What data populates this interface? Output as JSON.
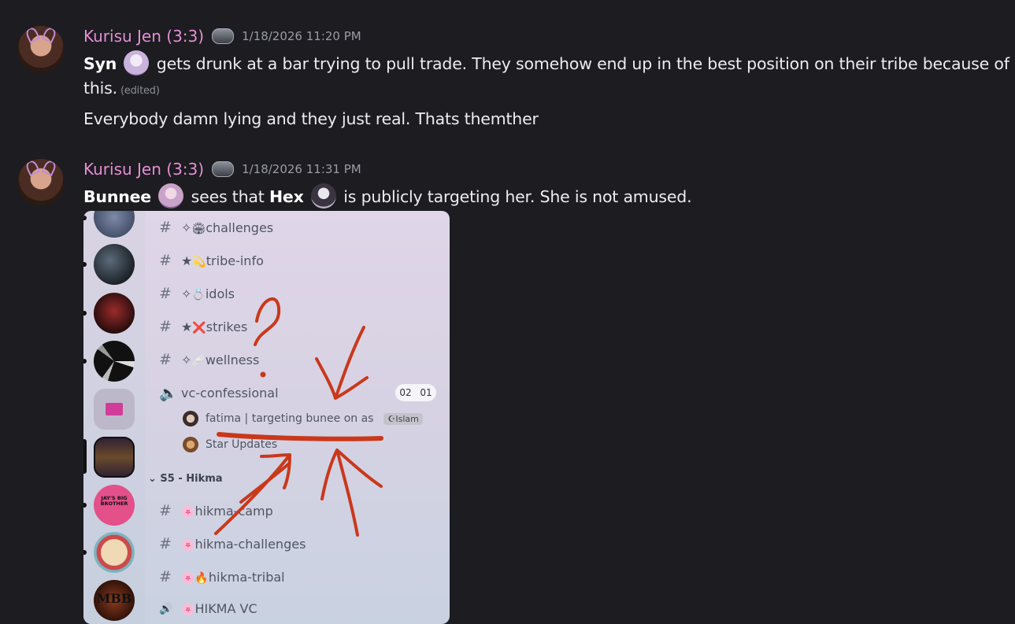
{
  "messages": [
    {
      "username": "Kurisu Jen (3:3)",
      "timestamp": "1/18/2026 11:20 PM",
      "line1_name": "Syn",
      "line1_text": "gets drunk at a bar trying to pull trade. They somehow end up in the best position on their tribe because of",
      "line2_text": "this.",
      "edited_label": "(edited)",
      "line3_text": "Everybody damn lying and they just real. Thats themther"
    },
    {
      "username": "Kurisu Jen (3:3)",
      "timestamp": "1/18/2026 11:31 PM",
      "name_a": "Bunnee",
      "text_a": "sees that",
      "name_b": "Hex",
      "text_b": "is publicly targeting her. She is not amused."
    }
  ],
  "embedded_screenshot": {
    "channels": [
      {
        "icon": "#",
        "prefix": "✧",
        "emoji": "🏟",
        "name": "challenges"
      },
      {
        "icon": "#",
        "prefix": "★",
        "emoji": "💫",
        "name": "tribe-info"
      },
      {
        "icon": "#",
        "prefix": "✧",
        "emoji": "💍",
        "name": "idols"
      },
      {
        "icon": "#",
        "prefix": "★",
        "emoji": "❌",
        "name": "strikes"
      },
      {
        "icon": "#",
        "prefix": "✧",
        "emoji": "🩹",
        "name": "wellness"
      }
    ],
    "voice_channel": {
      "name": "vc-confessional",
      "count_a": "02",
      "count_b": "01",
      "users": [
        {
          "name": "fatima | targeting bunee on as",
          "tag": "Islam"
        },
        {
          "name": "Star Updates"
        }
      ]
    },
    "category": "S5 - Hikma",
    "hikma_channels": [
      {
        "icon": "#",
        "emoji": "🌸",
        "name": "hikma-camp"
      },
      {
        "icon": "#",
        "emoji": "🌸",
        "name": "hikma-challenges"
      },
      {
        "icon": "#",
        "emoji": "🌸🔥",
        "name": "hikma-tribal"
      },
      {
        "icon": "🔊",
        "emoji": "🌸",
        "name": "HIKMA VC"
      }
    ],
    "guild_labels": [
      "JAY'S BIG BROTHER",
      "MBB"
    ]
  }
}
